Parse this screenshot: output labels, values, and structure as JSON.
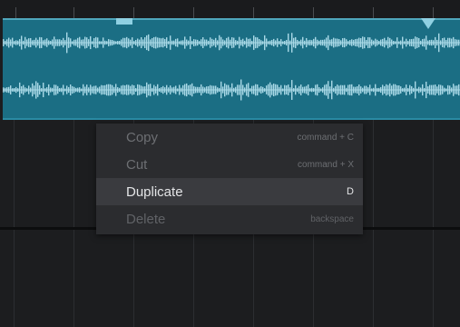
{
  "track": {
    "waveform_color": "#a9d9e6",
    "clip_color": "#1b6e84"
  },
  "context_menu": {
    "items": [
      {
        "label": "Copy",
        "shortcut": "command + C",
        "state": "normal"
      },
      {
        "label": "Cut",
        "shortcut": "command + X",
        "state": "normal"
      },
      {
        "label": "Duplicate",
        "shortcut": "D",
        "state": "highlighted"
      },
      {
        "label": "Delete",
        "shortcut": "backspace",
        "state": "disabled"
      }
    ]
  }
}
